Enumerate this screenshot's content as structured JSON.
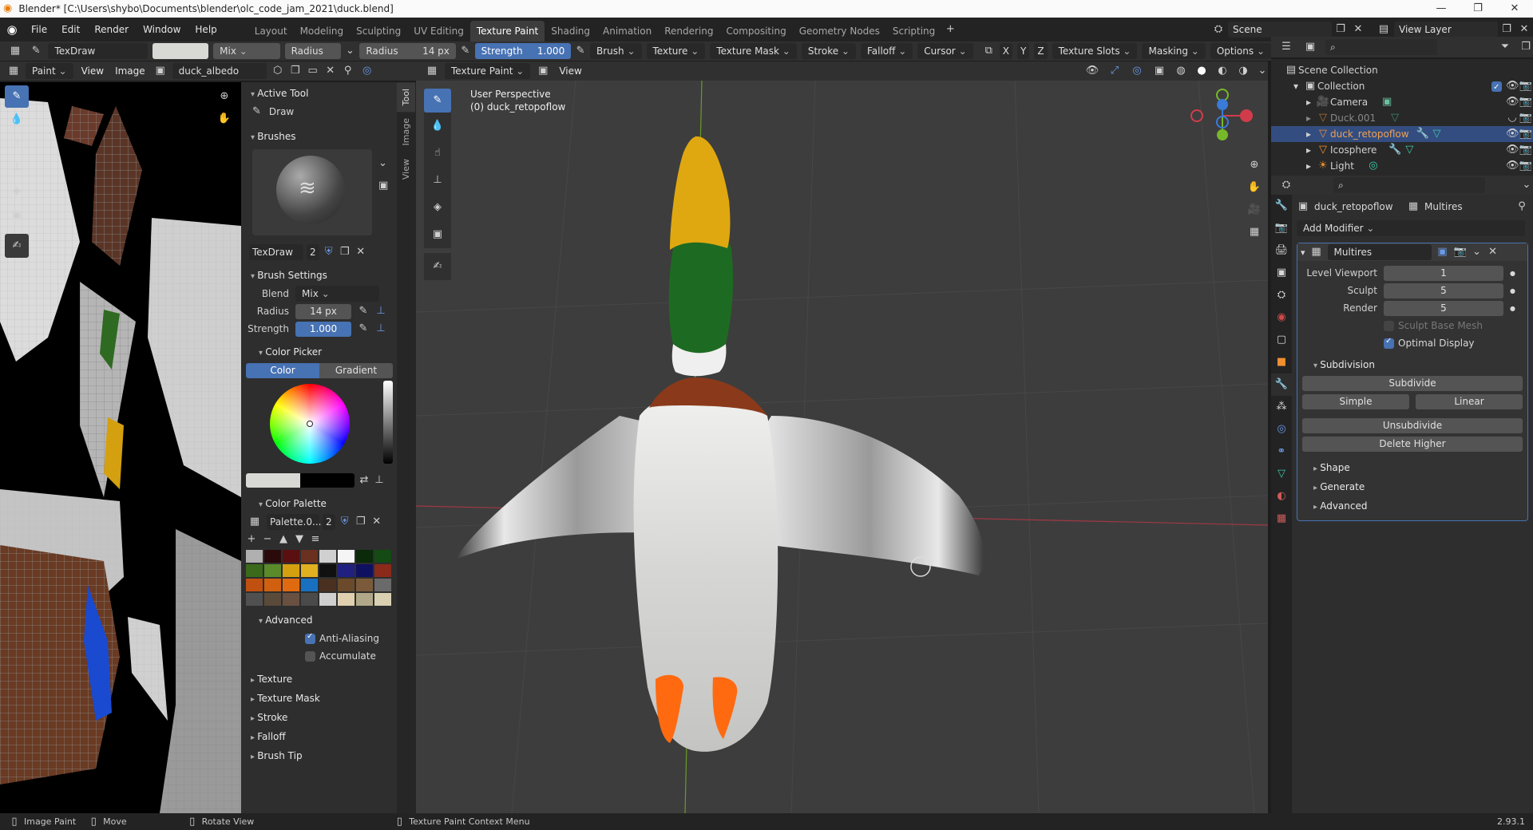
{
  "titlebar": {
    "title": "Blender* [C:\\Users\\shybo\\Documents\\blender\\olc_code_jam_2021\\duck.blend]",
    "minimize": "—",
    "maximize": "❐",
    "close": "✕"
  },
  "menu": {
    "items": [
      "File",
      "Edit",
      "Render",
      "Window",
      "Help"
    ]
  },
  "workspaces": [
    "Layout",
    "Modeling",
    "Sculpting",
    "UV Editing",
    "Texture Paint",
    "Shading",
    "Animation",
    "Rendering",
    "Compositing",
    "Geometry Nodes",
    "Scripting"
  ],
  "active_workspace": "Texture Paint",
  "scene": {
    "scene_name": "Scene",
    "view_layer": "View Layer"
  },
  "tool_header": {
    "brush_name": "TexDraw",
    "blend": "Mix",
    "radius_tab": "Radius",
    "radius_label": "Radius",
    "radius_value": "14 px",
    "strength_label": "Strength",
    "strength_value": "1.000",
    "menus": [
      "Brush",
      "Texture",
      "Texture Mask",
      "Stroke",
      "Falloff",
      "Cursor"
    ],
    "right_menus": [
      "Texture Slots",
      "Masking",
      "Options"
    ],
    "axes": [
      "X",
      "Y",
      "Z"
    ]
  },
  "image_editor": {
    "mode": "Paint",
    "view": "View",
    "image": "Image",
    "image_name": "duck_albedo"
  },
  "viewport_header": {
    "mode": "Texture Paint",
    "view": "View"
  },
  "viewport": {
    "perspective": "User Perspective",
    "object": "(0) duck_retopoflow"
  },
  "sidebar": {
    "tabs": [
      "Tool",
      "Image",
      "View"
    ],
    "active_tool_title": "Active Tool",
    "active_tool": "Draw",
    "brushes_title": "Brushes",
    "brush_name": "TexDraw",
    "brush_users": "2",
    "brush_settings_title": "Brush Settings",
    "blend_label": "Blend",
    "blend_value": "Mix",
    "radius_label": "Radius",
    "radius_value": "14 px",
    "strength_label": "Strength",
    "strength_value": "1.000",
    "color_picker_title": "Color Picker",
    "color_tab": "Color",
    "gradient_tab": "Gradient",
    "color_palette_title": "Color Palette",
    "palette_name": "Palette.0...",
    "palette_users": "2",
    "advanced_title": "Advanced",
    "anti_aliasing": "Anti-Aliasing",
    "accumulate": "Accumulate",
    "closed_panels": [
      "Texture",
      "Texture Mask",
      "Stroke",
      "Falloff",
      "Brush Tip"
    ]
  },
  "palette_colors": [
    "#b0b0b0",
    "#2a0a0a",
    "#5a1010",
    "#6a3020",
    "#d0d0d0",
    "#f5f5f5",
    "#0a2a0a",
    "#144a14",
    "#3a6a1a",
    "#5a8a2a",
    "#d4a010",
    "#e0b020",
    "#101010",
    "#202080",
    "#101060",
    "#8a2a1a",
    "#c05010",
    "#d06010",
    "#e06a10",
    "#1a70c0",
    "#4a3020",
    "#6a4a2a",
    "#7a5a3a",
    "#6a6a6a",
    "#505050",
    "#5a4a3a",
    "#6a5040",
    "#4a4a4a",
    "#cfcfcf",
    "#e0d0b0",
    "#b0a888",
    "#d8d0b0"
  ],
  "outliner": {
    "root": "Scene Collection",
    "collection": "Collection",
    "items": [
      {
        "name": "Camera",
        "type": "camera"
      },
      {
        "name": "Duck.001",
        "type": "mesh"
      },
      {
        "name": "duck_retopoflow",
        "type": "mesh"
      },
      {
        "name": "Icosphere",
        "type": "mesh"
      },
      {
        "name": "Light",
        "type": "light"
      }
    ]
  },
  "properties": {
    "object_name": "duck_retopoflow",
    "modifier_context": "Multires",
    "add_modifier": "Add Modifier",
    "modifier_name": "Multires",
    "level_viewport_label": "Level Viewport",
    "level_viewport": "1",
    "sculpt_label": "Sculpt",
    "sculpt": "5",
    "render_label": "Render",
    "render": "5",
    "sculpt_base_mesh": "Sculpt Base Mesh",
    "optimal_display": "Optimal Display",
    "subdivision_title": "Subdivision",
    "subdivide": "Subdivide",
    "simple": "Simple",
    "linear": "Linear",
    "unsubdivide": "Unsubdivide",
    "delete_higher": "Delete Higher",
    "closed": [
      "Shape",
      "Generate",
      "Advanced"
    ]
  },
  "statusbar": {
    "image_paint": "Image Paint",
    "move": "Move",
    "rotate": "Rotate View",
    "context": "Texture Paint Context Menu",
    "version": "2.93.1"
  },
  "colors": {
    "accent": "#4772b3",
    "selection": "#334d80",
    "beak": "#e0a810",
    "head": "#1d6b22",
    "feet": "#ff6a10",
    "x_axis": "#d23c4a",
    "y_axis": "#76b82a",
    "z_axis": "#3a7ad8"
  }
}
